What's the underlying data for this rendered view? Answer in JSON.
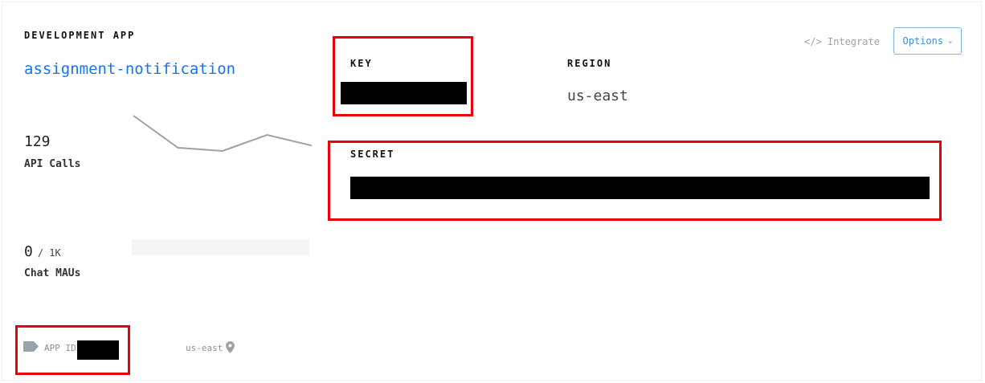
{
  "app": {
    "section_label": "DEVELOPMENT APP",
    "name": "assignment-notification"
  },
  "metrics": {
    "api_calls": {
      "value": "129",
      "label": "API Calls",
      "sparkline": [
        152,
        182,
        185,
        170,
        180
      ]
    },
    "chat_maus": {
      "value": "0",
      "limit": "/ 1K",
      "label": "Chat MAUs",
      "usage_fraction": 0
    }
  },
  "credentials": {
    "key_label": "KEY",
    "region_label": "REGION",
    "region_value": "us-east",
    "secret_label": "SECRET"
  },
  "toolbar": {
    "integrate_label": "</> Integrate",
    "options_label": "Options"
  },
  "footer": {
    "app_id_label": "APP ID:",
    "region": "us-east"
  },
  "colors": {
    "accent": "#1a73e8",
    "highlight": "#e8000b",
    "sparkline": "#9ca1ab"
  }
}
